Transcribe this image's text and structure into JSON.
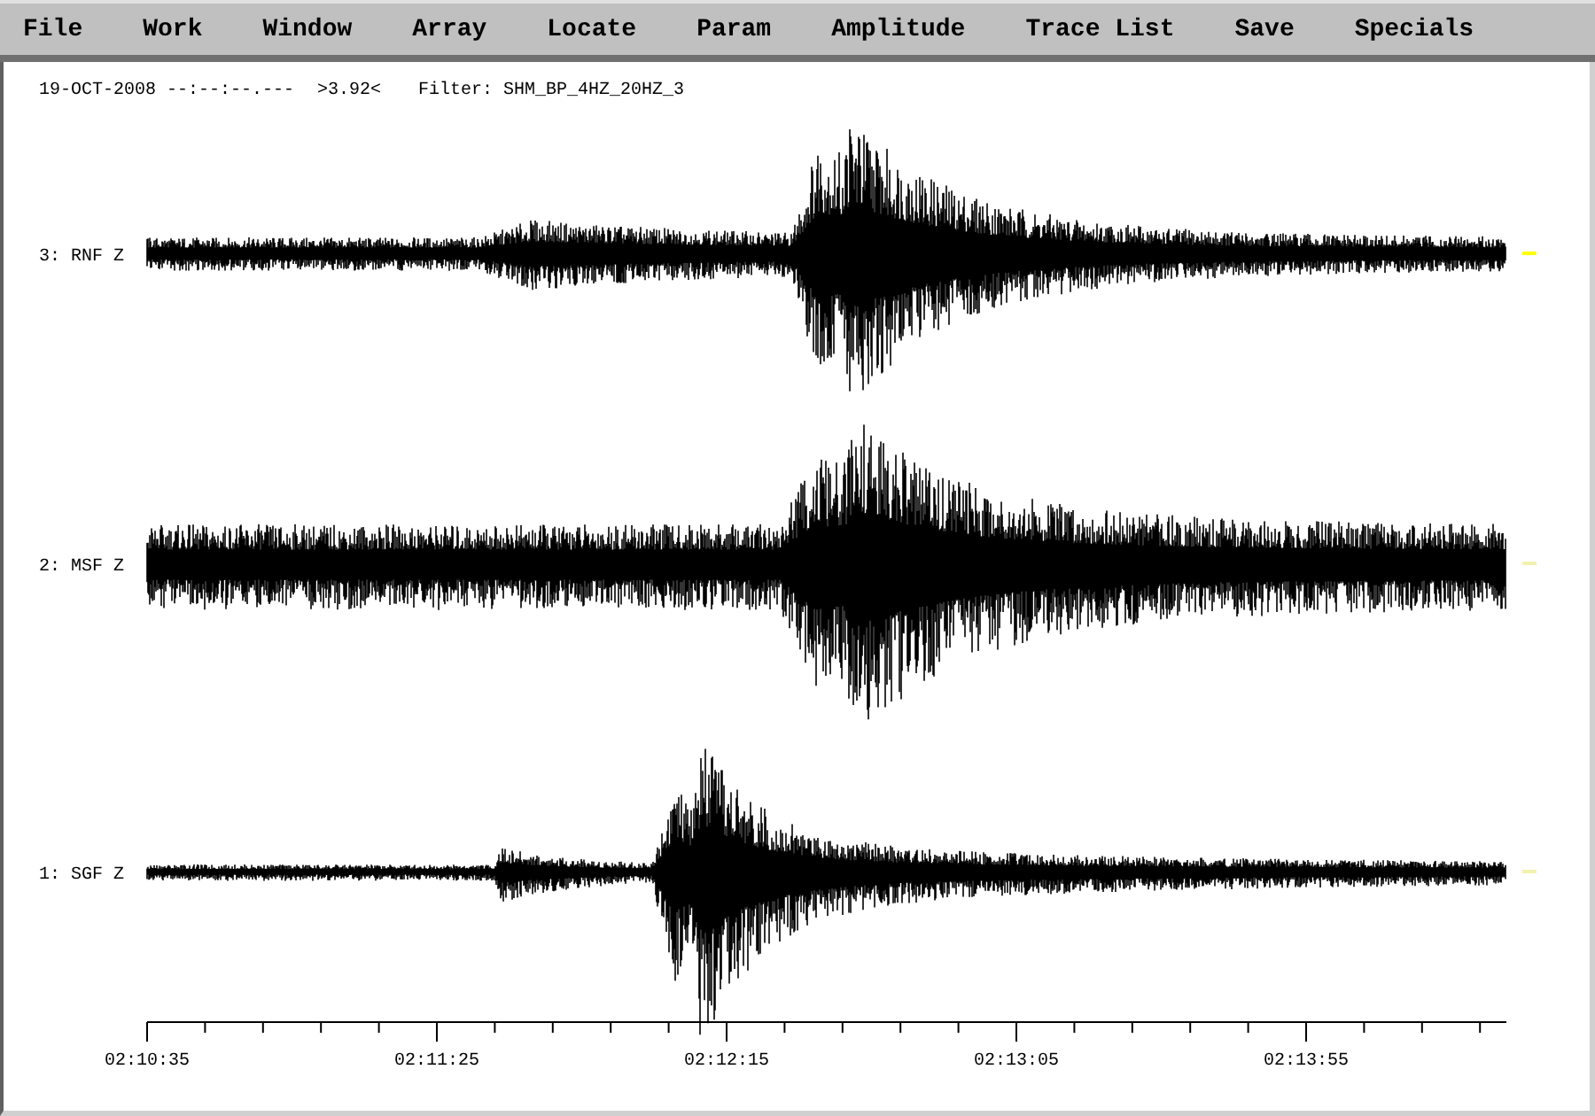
{
  "menu": [
    "File",
    "Work",
    "Window",
    "Array",
    "Locate",
    "Param",
    "Amplitude",
    "Trace List",
    "Save",
    "Specials"
  ],
  "header": {
    "date": "19-OCT-2008 --:--:--.---",
    "amplitude": ">3.92<",
    "filter": "Filter: SHM_BP_4HZ_20HZ_3"
  },
  "traces": [
    {
      "label": "3: RNF Z",
      "color": "#ffff00"
    },
    {
      "label": "2: MSF Z",
      "color": "#f2f2b0"
    },
    {
      "label": "1: SGF Z",
      "color": "#f2f2b0"
    }
  ],
  "time_axis": [
    "02:10:35",
    "02:11:25",
    "02:12:15",
    "02:13:05",
    "02:13:55"
  ]
}
